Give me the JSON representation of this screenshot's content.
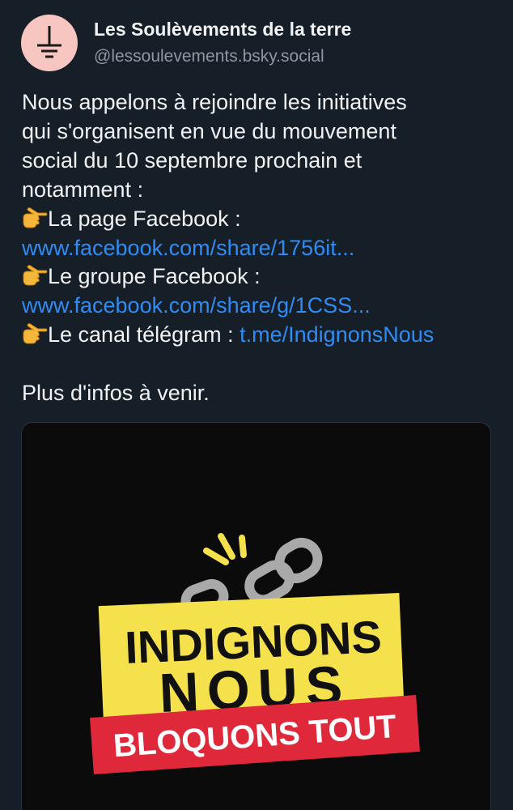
{
  "author": {
    "display_name": "Les Soulèvements de la terre",
    "handle": "@lessoulevements.bsky.social",
    "avatar_icon": "earth-ground-symbol-icon"
  },
  "post": {
    "line1": "Nous appelons à rejoindre les initiatives",
    "line2": "qui s'organisent en vue du mouvement",
    "line3": "social du 10 septembre prochain et",
    "line4": "notamment :",
    "item1_label": "La page Facebook :",
    "item1_link": "www.facebook.com/share/1756it...",
    "item2_label": "Le groupe Facebook :",
    "item2_link": "www.facebook.com/share/g/1CSS...",
    "item3_label": "Le canal télégram : ",
    "item3_link": "t.me/IndignonsNous",
    "closing": "Plus d'infos à venir.",
    "pointing_emoji": "backhand-index-pointing-right"
  },
  "image": {
    "line1": "INDIGNONS",
    "line2": "NOUS",
    "line3": "BLOQUONS TOUT",
    "colors": {
      "background": "#0b0b0c",
      "yellow": "#f4e14b",
      "red": "#e0283b",
      "chain": "#a9a9a9"
    }
  }
}
